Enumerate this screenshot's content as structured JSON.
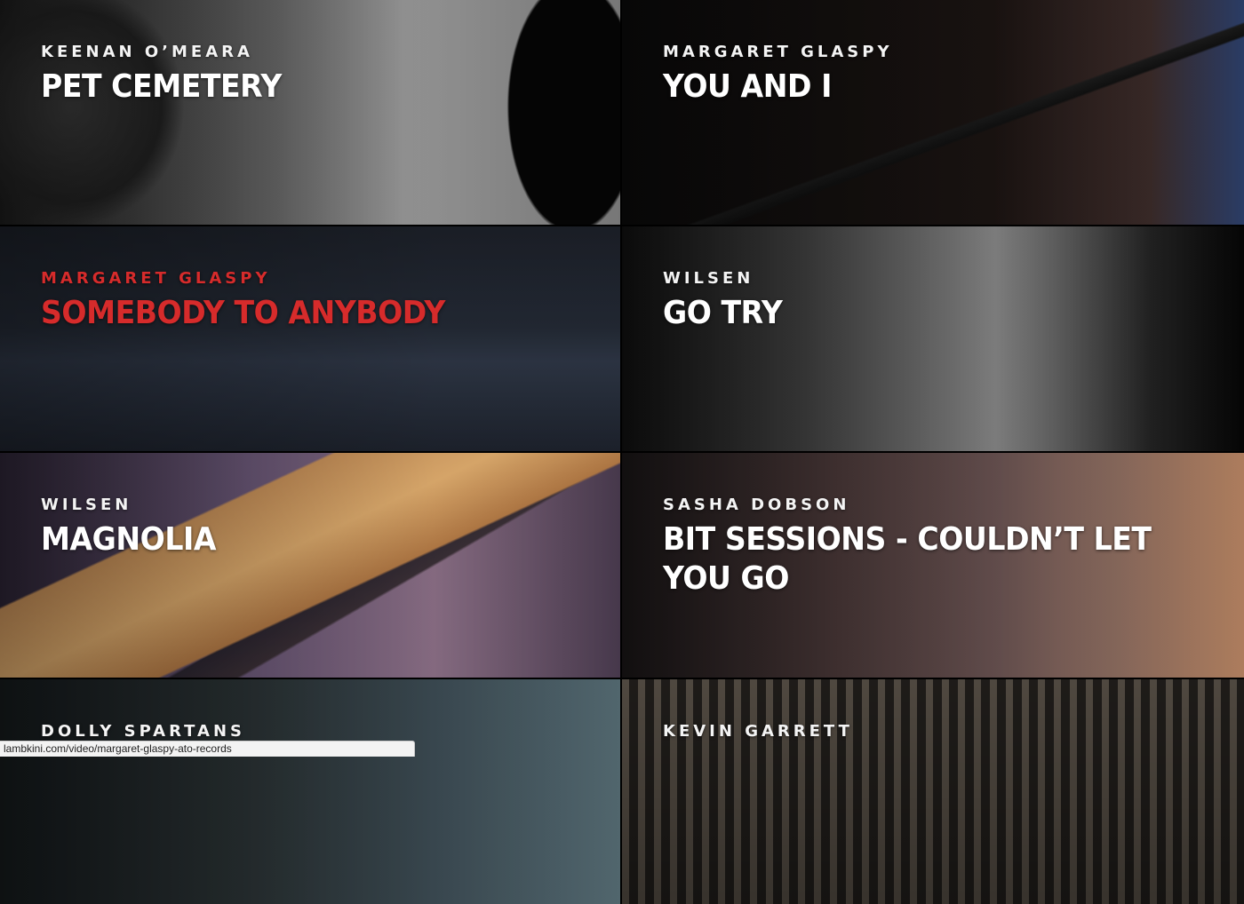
{
  "videos": [
    {
      "artist": "KEENAN O’MEARA",
      "title": "PET CEMETERY"
    },
    {
      "artist": "MARGARET GLASPY",
      "title": "YOU AND I"
    },
    {
      "artist": "MARGARET GLASPY",
      "title": "SOMEBODY TO ANYBODY"
    },
    {
      "artist": "WILSEN",
      "title": "GO TRY"
    },
    {
      "artist": "WILSEN",
      "title": "MAGNOLIA"
    },
    {
      "artist": "SASHA DOBSON",
      "title": "BIT SESSIONS - COULDN’T LET YOU GO"
    },
    {
      "artist": "DOLLY SPARTANS",
      "title": ""
    },
    {
      "artist": "KEVIN GARRETT",
      "title": ""
    }
  ],
  "status_bar": {
    "url": "lambkini.com/video/margaret-glaspy-ato-records"
  },
  "colors": {
    "active_red": "#d62b2b",
    "text_white": "#ffffff",
    "background": "#000000"
  }
}
